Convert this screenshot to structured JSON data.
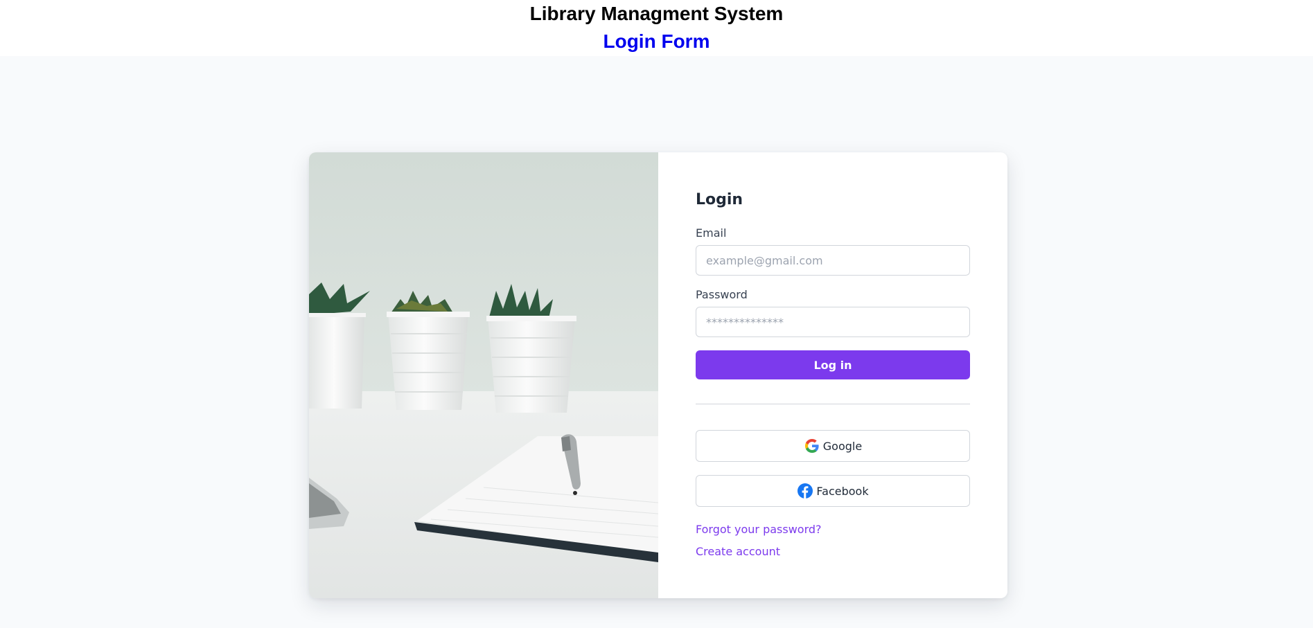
{
  "header": {
    "title": "Library Managment System",
    "subtitle": "Login Form"
  },
  "login": {
    "heading": "Login",
    "email_label": "Email",
    "email_placeholder": "example@gmail.com",
    "password_label": "Password",
    "password_placeholder": "**************",
    "submit_label": "Log in"
  },
  "social": {
    "google_label": "Google",
    "google_icon": "google-icon",
    "facebook_label": "Facebook",
    "facebook_icon": "facebook-icon"
  },
  "links": {
    "forgot_password": "Forgot your password?",
    "create_account": "Create account"
  },
  "colors": {
    "accent": "#7c3aed",
    "subtitle": "#0000ee",
    "page_background": "#f8fafc"
  }
}
